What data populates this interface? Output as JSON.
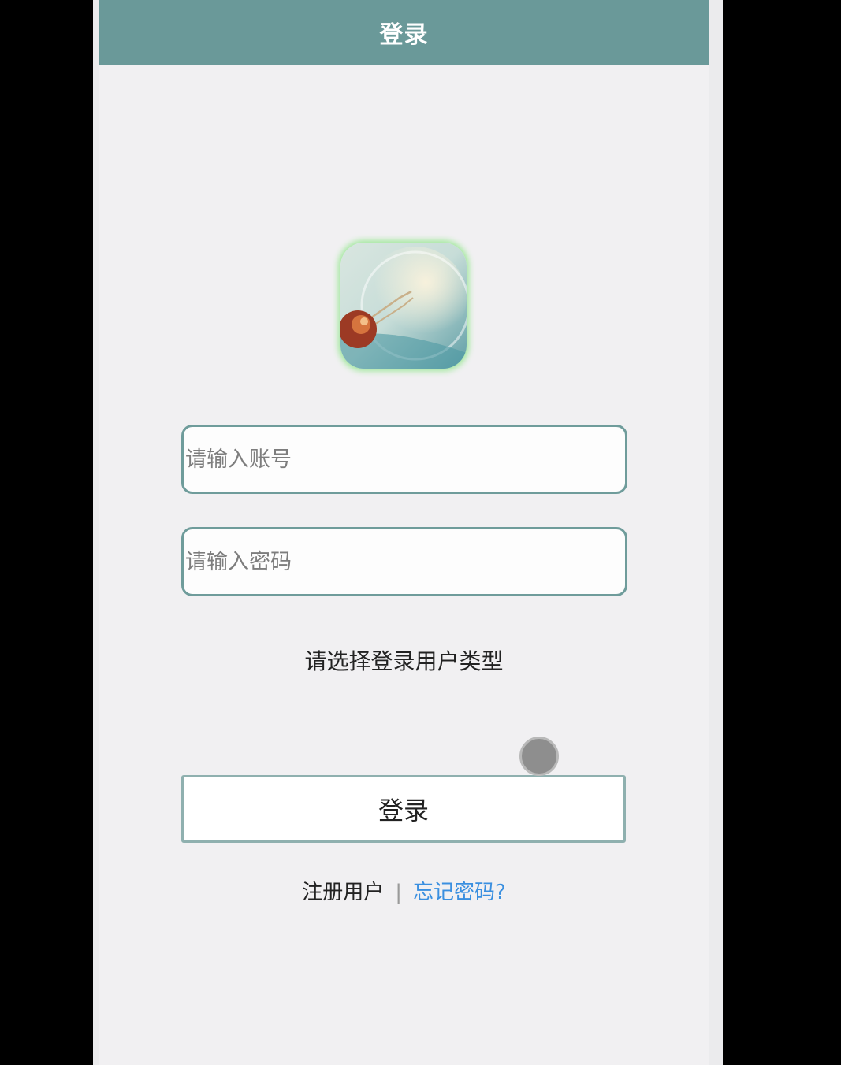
{
  "header": {
    "title": "登录"
  },
  "logo": {
    "icon": "lightbulb-image"
  },
  "form": {
    "account_placeholder": "请输入账号",
    "password_placeholder": "请输入密码",
    "user_type_label": "请选择登录用户类型",
    "login_label": "登录"
  },
  "links": {
    "register_label": "注册用户",
    "separator": "|",
    "forgot_label": "忘记密码?"
  },
  "colors": {
    "header_bg": "#6a9999",
    "field_border": "#6f9c9b",
    "link_blue": "#3a8fe0",
    "logo_glow": "#9fe89a"
  }
}
